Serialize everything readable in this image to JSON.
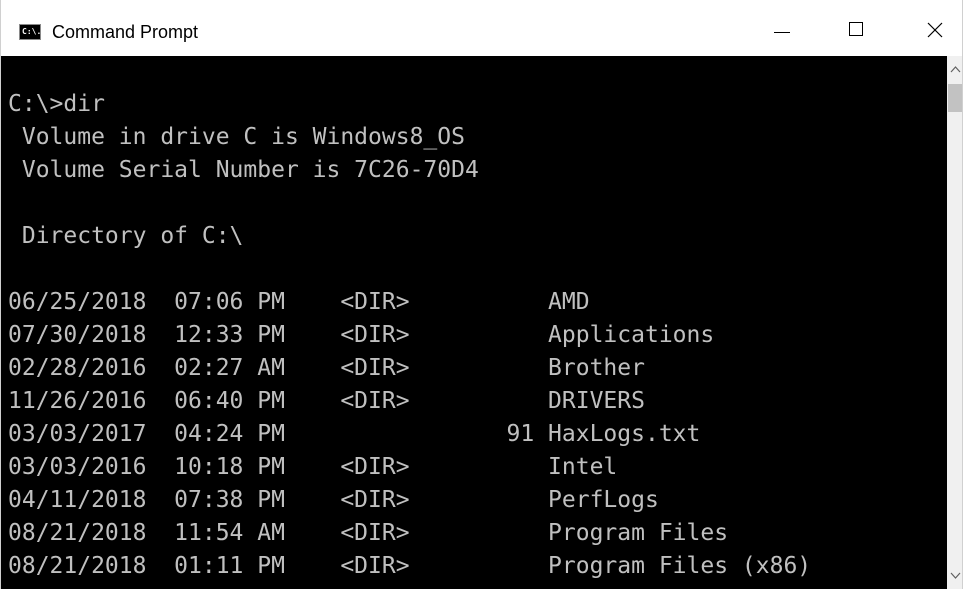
{
  "window": {
    "title": "Command Prompt",
    "icon_text": "C:\\."
  },
  "console": {
    "lines": [
      "",
      "C:\\>dir",
      " Volume in drive C is Windows8_OS",
      " Volume Serial Number is 7C26-70D4",
      "",
      " Directory of C:\\",
      "",
      "06/25/2018  07:06 PM    <DIR>          AMD",
      "07/30/2018  12:33 PM    <DIR>          Applications",
      "02/28/2016  02:27 AM    <DIR>          Brother",
      "11/26/2016  06:40 PM    <DIR>          DRIVERS",
      "03/03/2017  04:24 PM                91 HaxLogs.txt",
      "03/03/2016  10:18 PM    <DIR>          Intel",
      "04/11/2018  07:38 PM    <DIR>          PerfLogs",
      "08/21/2018  11:54 AM    <DIR>          Program Files",
      "08/21/2018  01:11 PM    <DIR>          Program Files (x86)"
    ]
  },
  "icons": {
    "app": "command-prompt-icon",
    "minimize": "minimize-icon",
    "maximize": "maximize-icon",
    "close": "close-icon",
    "scroll_up": "chevron-up-icon",
    "scroll_down": "chevron-down-icon"
  },
  "colors": {
    "console_bg": "#000000",
    "console_fg": "#c0c0c0",
    "titlebar_bg": "#ffffff"
  }
}
